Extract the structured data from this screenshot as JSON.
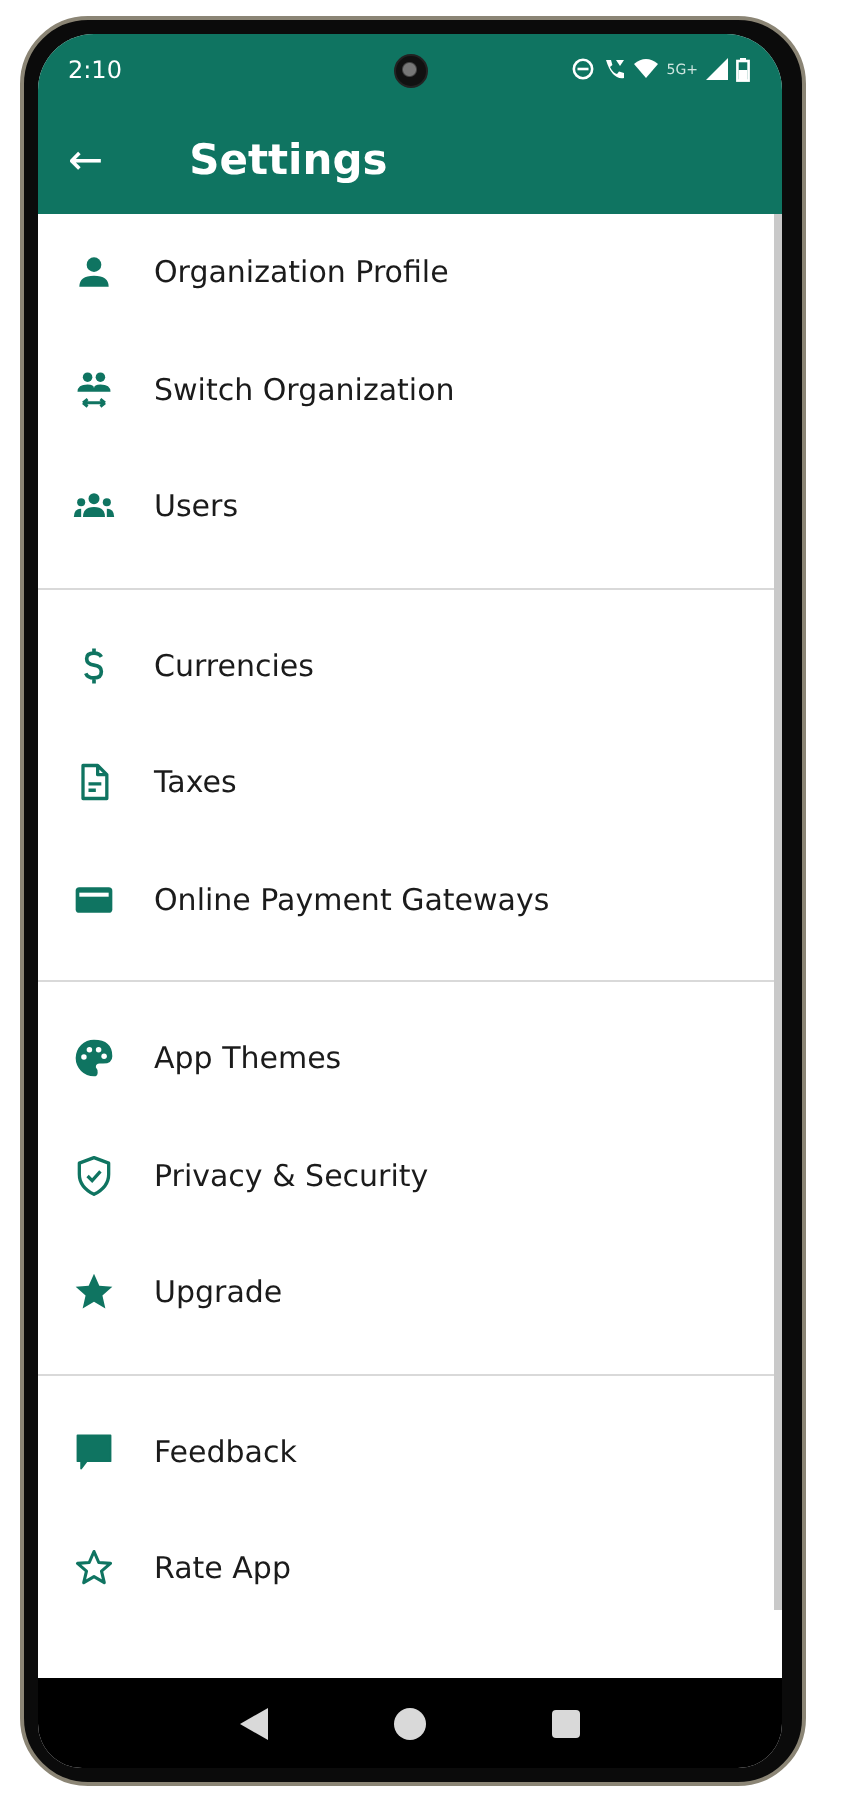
{
  "status_bar": {
    "time": "2:10",
    "network": "5G+"
  },
  "app_bar": {
    "back": "←",
    "title": "Settings"
  },
  "sections": [
    {
      "items": [
        "Organization Profile",
        "Switch Organization",
        "Users"
      ]
    },
    {
      "items": [
        "Currencies",
        "Taxes",
        "Online Payment Gateways"
      ]
    },
    {
      "items": [
        "App Themes",
        "Privacy & Security",
        "Upgrade"
      ]
    },
    {
      "items": [
        "Feedback",
        "Rate App"
      ]
    }
  ]
}
